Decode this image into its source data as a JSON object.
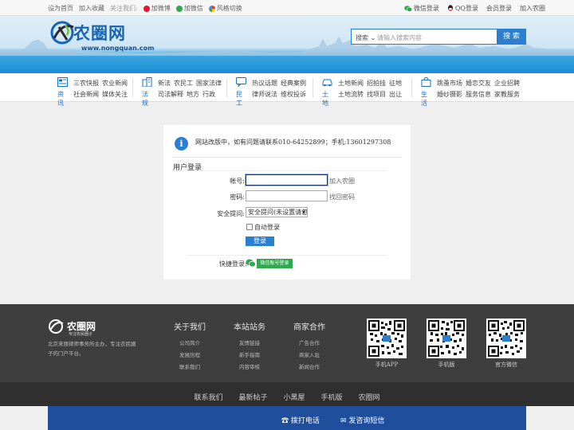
{
  "topbar": {
    "set_home": "设为首页",
    "add_favorite": "加入收藏",
    "follow_us": "关注我们:",
    "weibo": "加微博",
    "weixin": "加微信",
    "style_switch": "风格切换",
    "wechat_login": "微信登录",
    "qq_login": "QQ登录",
    "member_login": "会员登录",
    "join": "加入农圈"
  },
  "logo": {
    "brand": "农圈网",
    "url": "www.nongquan.com"
  },
  "search": {
    "scope": "搜索",
    "placeholder": "请输入搜索内容",
    "button": "搜 索"
  },
  "nav": [
    {
      "cat": "资讯",
      "row1": [
        "三农快报",
        "农业新闻"
      ],
      "row2": [
        "社会新闻",
        "媒体关注"
      ]
    },
    {
      "cat": "法规",
      "row1": [
        "新法",
        "农民工",
        "国家法律"
      ],
      "row2": [
        "司法解释",
        "地方",
        "行政"
      ]
    },
    {
      "cat": "民工",
      "row1": [
        "热议话题",
        "经典案例"
      ],
      "row2": [
        "律师说法",
        "维权投诉"
      ]
    },
    {
      "cat": "土地",
      "row1": [
        "土地新闻",
        "招拍挂",
        "征地"
      ],
      "row2": [
        "土地流转",
        "找项目",
        "出让"
      ]
    },
    {
      "cat": "生活",
      "row1": [
        "跳蚤市场",
        "婚恋交友",
        "企业招聘"
      ],
      "row2": [
        "婚纱摄影",
        "服务信息",
        "家教服务"
      ]
    }
  ],
  "login": {
    "notice": "网站改版中，如有问题请联系010-64252899；手机:13601297308",
    "title": "用户登录",
    "account_label": "帐号:",
    "join_link": "加入农圈",
    "password_label": "密码:",
    "forgot_link": "找回密码",
    "security_label": "安全提问:",
    "security_value": "安全提问(未设置请忽略)",
    "remember": "自动登录",
    "submit": "登录",
    "quick_label": "快捷登录:",
    "wechat_button": "微信账号登录"
  },
  "footer": {
    "brand": "农圈网",
    "slogan": "专注农民圈子",
    "desc": "北京来丽律师事务所主办，专注农民圈子的门户平台。",
    "cols": [
      {
        "h": "关于我们",
        "links": [
          "公司简介",
          "发展历程",
          "联系我们"
        ]
      },
      {
        "h": "本站站务",
        "links": [
          "友情链接",
          "新手指南",
          "内容审核"
        ]
      },
      {
        "h": "商家合作",
        "links": [
          "广告合作",
          "商家入驻",
          "新闻合作"
        ]
      }
    ],
    "qrcodes": [
      "手机APP",
      "手机版",
      "官方微信"
    ],
    "bottom_links": [
      "联系我们",
      "最新帖子",
      "小黑屋",
      "手机版",
      "农圈网"
    ],
    "call": "☎ 拨打电话",
    "sms": "✉ 发咨询短信"
  },
  "colors": {
    "primary": "#2a7fd0",
    "wechat": "#2fa84f",
    "footer": "#3e3e3e",
    "bluebar": "#1f4e9c"
  }
}
